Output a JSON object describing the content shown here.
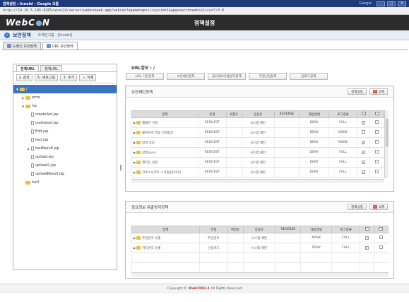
{
  "window": {
    "title": "접책설정 : fnnelsi - Google 크롬",
    "google_label": "Google",
    "url": "http://10.10.5.195:8265/wcon24/server/webconweb.app/webcon?appmetapolicyscid=1&apgsearch=webcolicy=7:0-0"
  },
  "app": {
    "logo_left": "WebC",
    "logo_right": "N",
    "title": "정책설정"
  },
  "breadcrumb": {
    "icon": "i",
    "page_title": "보안정책",
    "group_label": "도메인그룹 : [fnnelsi]"
  },
  "top_tabs": [
    {
      "label": "도메인 보안정책"
    },
    {
      "label": "URL 보안정책"
    }
  ],
  "left": {
    "tabs": [
      {
        "label": "전체URL"
      },
      {
        "label": "정책URL"
      }
    ],
    "toolbar": {
      "search": "검색",
      "refresh": "새로고침",
      "add": "추가",
      "delete": "삭제"
    },
    "tree": [
      {
        "label": "/",
        "kind": "folder",
        "depth": 0,
        "exp": "▼",
        "sel": true
      },
      {
        "label": "error",
        "kind": "folder",
        "depth": 1,
        "exp": "▶",
        "sel": false
      },
      {
        "label": "tsc",
        "kind": "folder",
        "depth": 1,
        "exp": "▼",
        "sel": false
      },
      {
        "label": "createSet.jsp",
        "kind": "doc",
        "depth": 2,
        "exp": "",
        "sel": false
      },
      {
        "label": "cookieset.jsp",
        "kind": "doc",
        "depth": 2,
        "exp": "",
        "sel": false
      },
      {
        "label": "Edit.jsp",
        "kind": "doc",
        "depth": 2,
        "exp": "",
        "sel": false
      },
      {
        "label": "test.jsp",
        "kind": "doc",
        "depth": 2,
        "exp": "",
        "sel": false
      },
      {
        "label": "testResult.jsp",
        "kind": "doc",
        "depth": 2,
        "exp": "▶",
        "sel": false
      },
      {
        "label": "upload.jsp",
        "kind": "doc",
        "depth": 2,
        "exp": "",
        "sel": false
      },
      {
        "label": "upload2.jsp",
        "kind": "doc",
        "depth": 2,
        "exp": "",
        "sel": false
      },
      {
        "label": "uploadResult.jsp",
        "kind": "doc",
        "depth": 2,
        "exp": "",
        "sel": false
      },
      {
        "label": "tsc2",
        "kind": "folder",
        "depth": 1,
        "exp": "",
        "sel": false
      }
    ]
  },
  "right": {
    "url_info": "URL정보 : /",
    "sub_tabs": [
      "URL 기본정책",
      "보안패턴정책",
      "중요정보유출방지정책",
      "부정근접정책",
      "업로드정책"
    ],
    "security": {
      "title": "보안패턴정책",
      "btn_set": "정책설정",
      "btn_delete": "삭제",
      "columns": [
        "정책",
        "유형",
        "위험도",
        "응용유",
        "REVERSE",
        "대응방법",
        "로그종류",
        "",
        ""
      ],
      "rows": [
        [
          "웹해커 선정",
          "REQUEST",
          "",
          "시스템 패턴",
          "",
          "DENY",
          "FULL",
          "✓",
          ""
        ],
        [
          "불미취약 파정 검색점조",
          "REQUEST",
          "",
          "시스템 패턴",
          "",
          "DENY",
          "NONE",
          "",
          ""
        ],
        [
          "탐색·공동",
          "REQUEST",
          "",
          "시스템 패턴",
          "",
          "DENY",
          "NONE",
          "✓",
          ""
        ],
        [
          "탐색·java",
          "REQUEST",
          "",
          "시스템 패턴",
          "",
          "DENY",
          "FULL",
          "✓",
          ""
        ],
        [
          "필터도 설정",
          "REQUEST",
          "",
          "시스템 패턴",
          "",
          "DENY",
          "FULL",
          "✓",
          ""
        ],
        [
          "크로스사이트 스크립팅(XSS)",
          "REQUEST",
          "",
          "시스템 패턴",
          "",
          "DENY",
          "FULL",
          "✓",
          ""
        ]
      ]
    },
    "leak": {
      "title": "중요정보 유출방지정책",
      "btn_set": "정책설정",
      "btn_delete": "삭제",
      "columns": [
        "정책",
        "유형",
        "위험도",
        "응용유",
        "REVERSE",
        "대응방법",
        "로그종류",
        "",
        ""
      ],
      "rows": [
        [
          "주민번호 유출",
          "주민번호",
          "",
          "시스템 패턴",
          "",
          "MASK",
          "FULL",
          "✓",
          ""
        ],
        [
          "카드번호 유출",
          "신용카드",
          "",
          "시스템 패턴",
          "",
          "DENY",
          "FULL",
          "✓",
          ""
        ]
      ]
    }
  },
  "footer": {
    "prefix": "Copyright ©",
    "brand": "WebCON2.4",
    "suffix": "All Rights Reserved"
  }
}
